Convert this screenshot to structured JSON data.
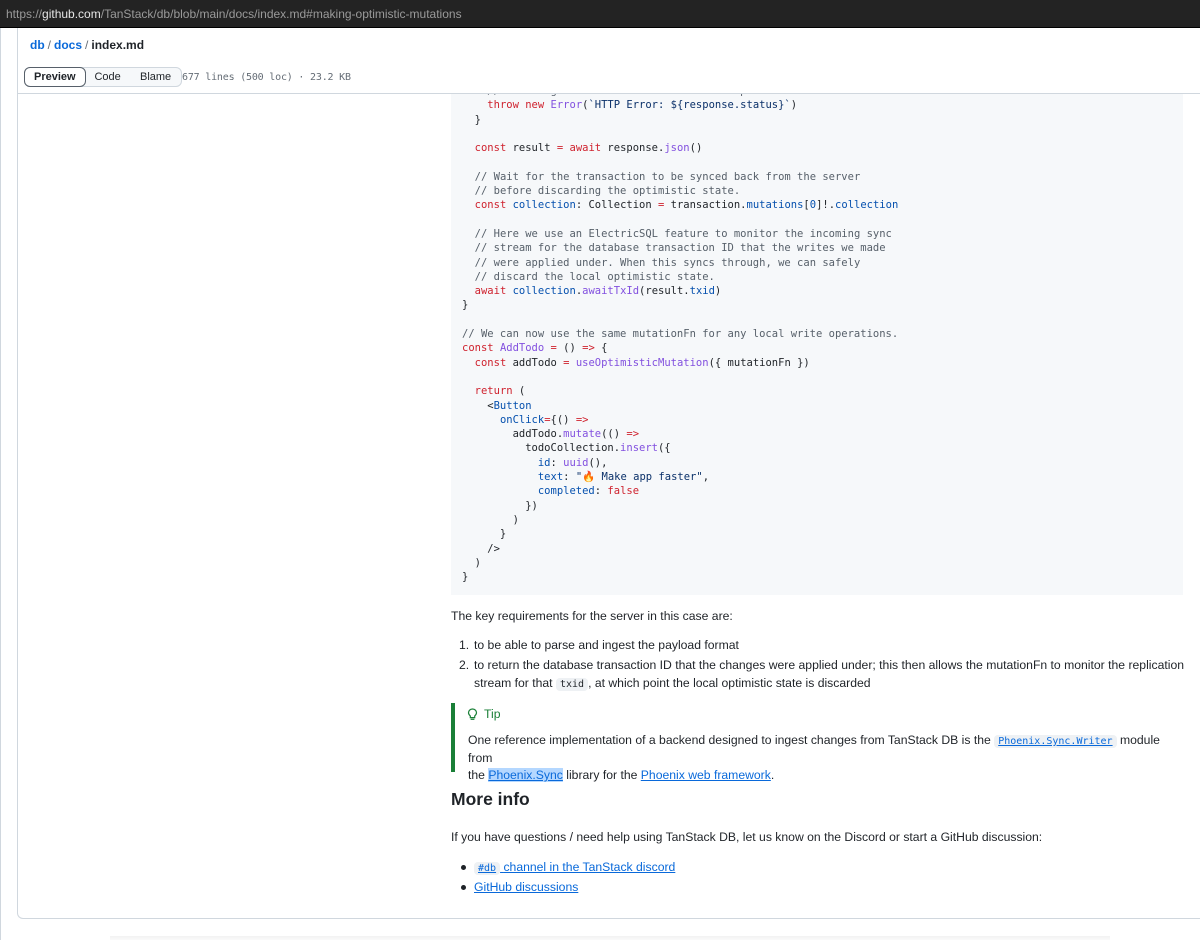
{
  "browser": {
    "url_prefix": "https://",
    "url_host": "github.com",
    "url_path": "/TanStack/db/blob/main/docs/index.md#making-optimistic-mutations"
  },
  "breadcrumb": {
    "repo": "db",
    "dir": "docs",
    "file": "index.md",
    "sep": "/"
  },
  "tabs": {
    "preview": "Preview",
    "code": "Code",
    "blame": "Blame"
  },
  "file_info": "677 lines (500 loc) · 23.2 KB",
  "code_lines": [
    "    // Throwing an error will rollback the optimistic state.",
    "    throw new Error(`HTTP Error: ${response.status}`)",
    "  }",
    "",
    "  const result = await response.json()",
    "",
    "  // Wait for the transaction to be synced back from the server",
    "  // before discarding the optimistic state.",
    "  const collection: Collection = transaction.mutations[0]!.collection",
    "",
    "  // Here we use an ElectricSQL feature to monitor the incoming sync",
    "  // stream for the database transaction ID that the writes we made",
    "  // were applied under. When this syncs through, we can safely",
    "  // discard the local optimistic state.",
    "  await collection.awaitTxId(result.txid)",
    "}",
    "",
    "// We can now use the same mutationFn for any local write operations.",
    "const AddTodo = () => {",
    "  const addTodo = useOptimisticMutation({ mutationFn })",
    "",
    "  return (",
    "    <Button",
    "      onClick={() =>",
    "        addTodo.mutate(() =>",
    "          todoCollection.insert({",
    "            id: uuid(),",
    "            text: \"🔥 Make app faster\",",
    "            completed: false",
    "          })",
    "        )",
    "      }",
    "    />",
    "  )",
    "}"
  ],
  "content": {
    "requirements_intro": "The key requirements for the server in this case are:",
    "req1_num": "1.",
    "req1": "to be able to parse and ingest the payload format",
    "req2_num": "2.",
    "req2_line1": "to return the database transaction ID that the changes were applied under; this then allows the mutationFn to monitor the replication",
    "req2_line2a": "stream for that",
    "req2_code": "txid",
    "req2_line2b": ", at which point the local optimistic state is discarded",
    "tip": {
      "title": "Tip",
      "text_a": "One reference implementation of a backend designed to ingest changes from TanStack DB is the",
      "code_link": "Phoenix.Sync.Writer",
      "text_b": "module from",
      "text_c": "the",
      "link1": "Phoenix.Sync",
      "text_d": "library for the",
      "link2": "Phoenix web framework",
      "text_e": "."
    },
    "more_info_heading": "More info",
    "more_info_text": "If you have questions / need help using TanStack DB, let us know on the Discord or start a GitHub discussion:",
    "link_discord_code": "#db",
    "link_discord_text": "channel in the TanStack discord",
    "link_github": "GitHub discussions"
  }
}
